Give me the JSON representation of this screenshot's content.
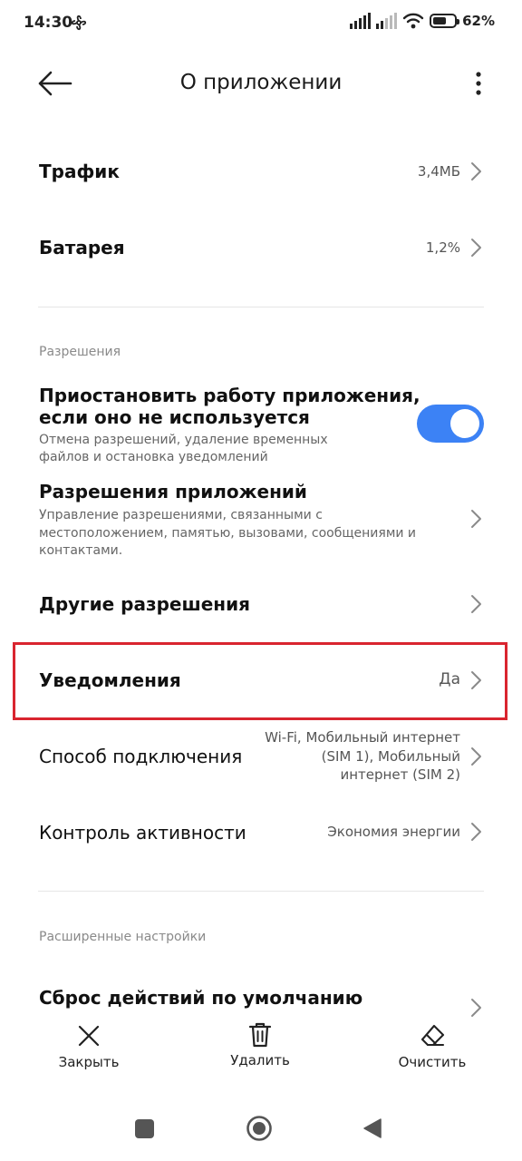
{
  "status_bar": {
    "time": "14:30",
    "battery_text": "62%",
    "battery_level": 0.62
  },
  "header": {
    "title": "О приложении"
  },
  "rows": {
    "traffic": {
      "label": "Трафик",
      "value": "3,4МБ"
    },
    "battery": {
      "label": "Батарея",
      "value": "1,2%"
    }
  },
  "permissions": {
    "section_label": "Разрешения",
    "pause": {
      "title_line1": "Приостановить работу приложения,",
      "title_line2": "если оно не используется",
      "sub_line1": "Отмена разрешений, удаление временных",
      "sub_line2": "файлов и остановка уведомлений",
      "enabled": true
    },
    "app_permissions": {
      "title": "Разрешения приложений",
      "sub_line1": "Управление разрешениями, связанными с",
      "sub_line2": "местоположением, памятью, вызовами, сообщениями и",
      "sub_line3": "контактами."
    },
    "other": {
      "label": "Другие разрешения"
    },
    "notifications": {
      "label": "Уведомления",
      "value": "Да"
    },
    "connection": {
      "label": "Способ подключения",
      "value_line1": "Wi-Fi, Мобильный интернет",
      "value_line2": "(SIM 1), Мобильный",
      "value_line3": "интернет (SIM 2)"
    },
    "activity": {
      "label": "Контроль активности",
      "value": "Экономия энергии"
    }
  },
  "advanced": {
    "section_label": "Расширенные настройки",
    "reset_defaults": {
      "label": "Сброс действий по умолчанию"
    }
  },
  "actions": {
    "close": "Закрыть",
    "delete": "Удалить",
    "clear": "Очистить"
  },
  "colors": {
    "accent": "#3c82f5",
    "highlight": "#d9252f"
  }
}
